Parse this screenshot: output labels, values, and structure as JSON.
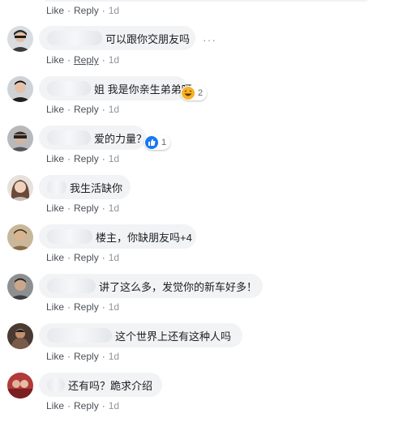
{
  "actions": {
    "like": "Like",
    "reply": "Reply",
    "sep": "·",
    "time": "1d"
  },
  "comments": [
    {
      "text": "可以跟你交朋友吗"
    },
    {
      "text": "姐 我是你亲生弟弟呀",
      "reaction": {
        "icon": "haha-emoji-icon",
        "count": "2"
      }
    },
    {
      "text": "爱的力量？",
      "reaction": {
        "icon": "like-thumb-icon",
        "count": "1"
      }
    },
    {
      "text": "我生活缺你"
    },
    {
      "text": "楼主，你缺朋友吗+4"
    },
    {
      "text": "讲了这么多，发觉你的新车好多！"
    },
    {
      "text": "这个世界上还有这种人吗"
    },
    {
      "text": "还有吗？跪求介绍"
    }
  ],
  "more_options": "···",
  "colors": {
    "bubble": "#f2f3f5",
    "action": "#4b4f56",
    "time": "#90949c",
    "like_blue": "#1877f2",
    "haha_yellow": "#f7b125"
  }
}
